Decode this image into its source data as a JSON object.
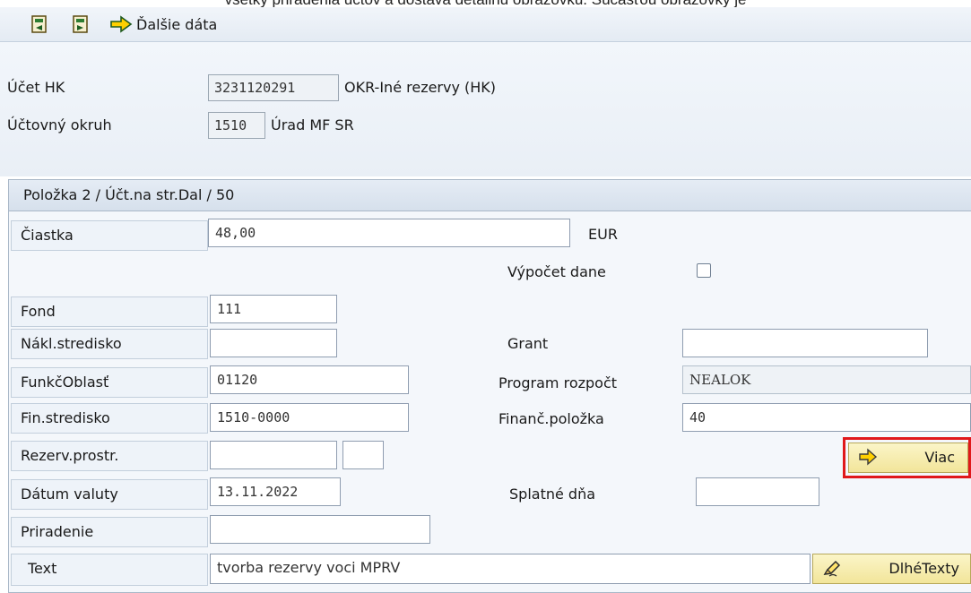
{
  "caption_fragment": "všetky priradenia účtov a dostavá detailnú obrazovku. Súčasťou obrazovky je",
  "toolbar": {
    "icon1": "document-prev-icon",
    "icon2": "document-next-icon",
    "icon3": "yellow-arrow-icon",
    "more_data_label": "Ďalšie dáta"
  },
  "header": {
    "gl_account_label": "Účet HK",
    "gl_account_value": "3231120291",
    "gl_account_desc": "OKR-Iné rezervy (HK)",
    "company_code_label": "Účtovný okruh",
    "company_code_value": "1510",
    "company_code_desc": "Úrad MF SR"
  },
  "item": {
    "title": "Položka 2 / Účt.na str.Dal / 50",
    "amount_label": "Čiastka",
    "amount_value": "48,00",
    "currency": "EUR",
    "tax_calc_label": "Výpočet dane",
    "tax_calc_checked": false,
    "fund_label": "Fond",
    "fund_value": "111",
    "cost_center_label": "Nákl.stredisko",
    "cost_center_value": "",
    "grant_label": "Grant",
    "grant_value": "",
    "func_area_label": "FunkčOblasť",
    "func_area_value": "01120",
    "budget_program_label": "Program rozpočt",
    "budget_program_value": "NEALOK",
    "fund_center_label": "Fin.stredisko",
    "fund_center_value": "1510-0000",
    "commitment_item_label": "Finanč.položka",
    "commitment_item_value": "40",
    "earmarked_label": "Rezerv.prostr.",
    "earmarked_value": "",
    "earmarked_item_value": "",
    "more_button_label": "Viac",
    "value_date_label": "Dátum valuty",
    "value_date_value": "13.11.2022",
    "due_on_label": "Splatné dňa",
    "due_on_value": "",
    "assignment_label": "Priradenie",
    "assignment_value": "",
    "text_label": "Text",
    "text_value": "tvorba rezervy voci MPRV",
    "long_texts_label": "DlhéTexty"
  },
  "colors": {
    "highlight": "#e0181b",
    "button_bg": "#f2e59a"
  }
}
